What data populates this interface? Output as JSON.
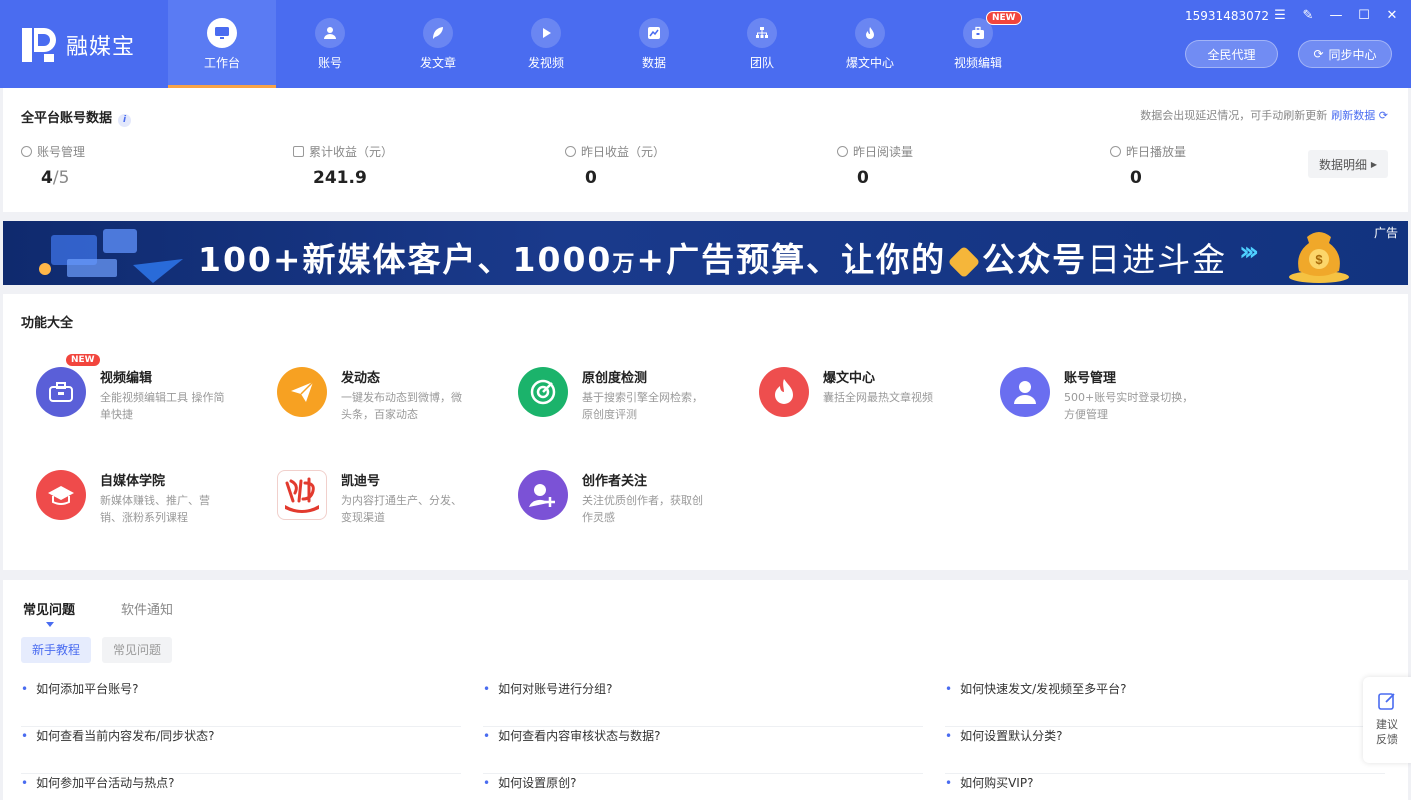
{
  "app": {
    "logo_text": "融媒宝",
    "phone": "15931483072"
  },
  "nav": [
    {
      "label": "工作台",
      "icon": "monitor-icon",
      "active": true
    },
    {
      "label": "账号",
      "icon": "user-icon"
    },
    {
      "label": "发文章",
      "icon": "feather-icon"
    },
    {
      "label": "发视频",
      "icon": "play-icon"
    },
    {
      "label": "数据",
      "icon": "chart-icon"
    },
    {
      "label": "团队",
      "icon": "org-icon"
    },
    {
      "label": "爆文中心",
      "icon": "fire-icon"
    },
    {
      "label": "视频编辑",
      "icon": "toolbox-icon",
      "badge": "NEW"
    }
  ],
  "header_buttons": {
    "agent": "全民代理",
    "sync": "同步中心"
  },
  "stats": {
    "title": "全平台账号数据",
    "note": "数据会出现延迟情况，可手动刷新更新",
    "refresh": "刷新数据",
    "detail_btn": "数据明细",
    "items": [
      {
        "label": "账号管理",
        "value": "4",
        "suffix": "/5"
      },
      {
        "label": "累计收益（元）",
        "value": "241.9"
      },
      {
        "label": "昨日收益（元）",
        "value": "0"
      },
      {
        "label": "昨日阅读量",
        "value": "0"
      },
      {
        "label": "昨日播放量",
        "value": "0"
      }
    ]
  },
  "banner": {
    "text_a": "100",
    "text_b": "+新媒体客户、",
    "text_c": "1000",
    "text_d": "万",
    "text_e": "+广告预算、让你的",
    "text_f": "公众号",
    "text_g": "日进斗金",
    "ad_tag": "广告"
  },
  "features": {
    "title": "功能大全",
    "items": [
      {
        "title": "视频编辑",
        "desc": "全能视频编辑工具 操作简单快捷",
        "badge": "NEW",
        "color": "#5a5fd8"
      },
      {
        "title": "发动态",
        "desc": "一键发布动态到微博，微头条，百家动态",
        "color": "#f7a122"
      },
      {
        "title": "原创度检测",
        "desc": "基于搜索引擎全网检索，原创度评测",
        "color": "#1bb36b"
      },
      {
        "title": "爆文中心",
        "desc": "囊括全网最热文章视频",
        "color": "#ee4e4e"
      },
      {
        "title": "账号管理",
        "desc": "500+账号实时登录切换，方便管理",
        "color": "#6a6ef0"
      },
      {
        "title": "自媒体学院",
        "desc": "新媒体赚钱、推广、营销、涨粉系列课程",
        "color": "#ef4b4b"
      },
      {
        "title": "凯迪号",
        "desc": "为内容打通生产、分发、变现渠道",
        "color": "#e23a2e"
      },
      {
        "title": "创作者关注",
        "desc": "关注优质创作者，获取创作灵感",
        "color": "#7b52d6"
      }
    ]
  },
  "faq": {
    "tabs": [
      "常见问题",
      "软件通知"
    ],
    "chips": [
      "新手教程",
      "常见问题"
    ],
    "questions": [
      "如何添加平台账号?",
      "如何对账号进行分组?",
      "如何快速发文/发视频至多平台?",
      "如何查看当前内容发布/同步状态?",
      "如何查看内容审核状态与数据?",
      "如何设置默认分类?",
      "如何参加平台活动与热点?",
      "如何设置原创?",
      "如何购买VIP?"
    ]
  },
  "feedback": "建议反馈",
  "colors": {
    "primary": "#4a6cf0",
    "accent_orange": "#f8a347",
    "badge_red": "#f2453d"
  }
}
